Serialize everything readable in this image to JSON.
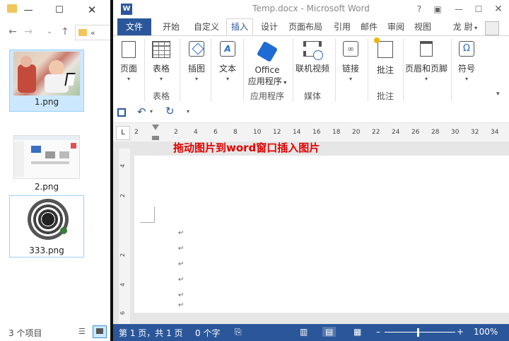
{
  "explorer": {
    "path_label": "«",
    "files": [
      {
        "name": "1.png"
      },
      {
        "name": "2.png"
      },
      {
        "name": "333.png"
      }
    ],
    "status_count": "3 个项目"
  },
  "word": {
    "title": "Temp.docx - Microsoft Word",
    "user": "龙 尉",
    "tabs": [
      "文件",
      "开始",
      "自定义",
      "插入",
      "设计",
      "页面布局",
      "引用",
      "邮件",
      "审阅",
      "视图"
    ],
    "ribbon": {
      "buttons": [
        {
          "label": "页面"
        },
        {
          "label": "表格"
        },
        {
          "label": "插图"
        },
        {
          "label": "文本"
        },
        {
          "label": "Office"
        },
        {
          "label": "应用程序"
        },
        {
          "label": "联机视频"
        },
        {
          "label": "链接"
        },
        {
          "label": "批注"
        },
        {
          "label": "页眉和页脚"
        },
        {
          "label": "符号"
        }
      ],
      "groups": [
        "表格",
        "应用程序",
        "媒体",
        "批注"
      ]
    },
    "ruler_ticks": [
      "2",
      "2",
      "4",
      "6",
      "8",
      "10",
      "12",
      "14",
      "16",
      "18",
      "20",
      "22",
      "24",
      "26",
      "28",
      "30",
      "32",
      "34"
    ],
    "vruler_ticks": [
      "4",
      "2",
      "2",
      "4",
      "6"
    ],
    "hint_text": "拖动图片到word窗口插入图片",
    "status": {
      "page": "第 1 页，共 1 页",
      "words": "0 个字",
      "zoom": "100%"
    },
    "colors": {
      "accent": "#2b579a",
      "hint": "#e00000"
    }
  }
}
